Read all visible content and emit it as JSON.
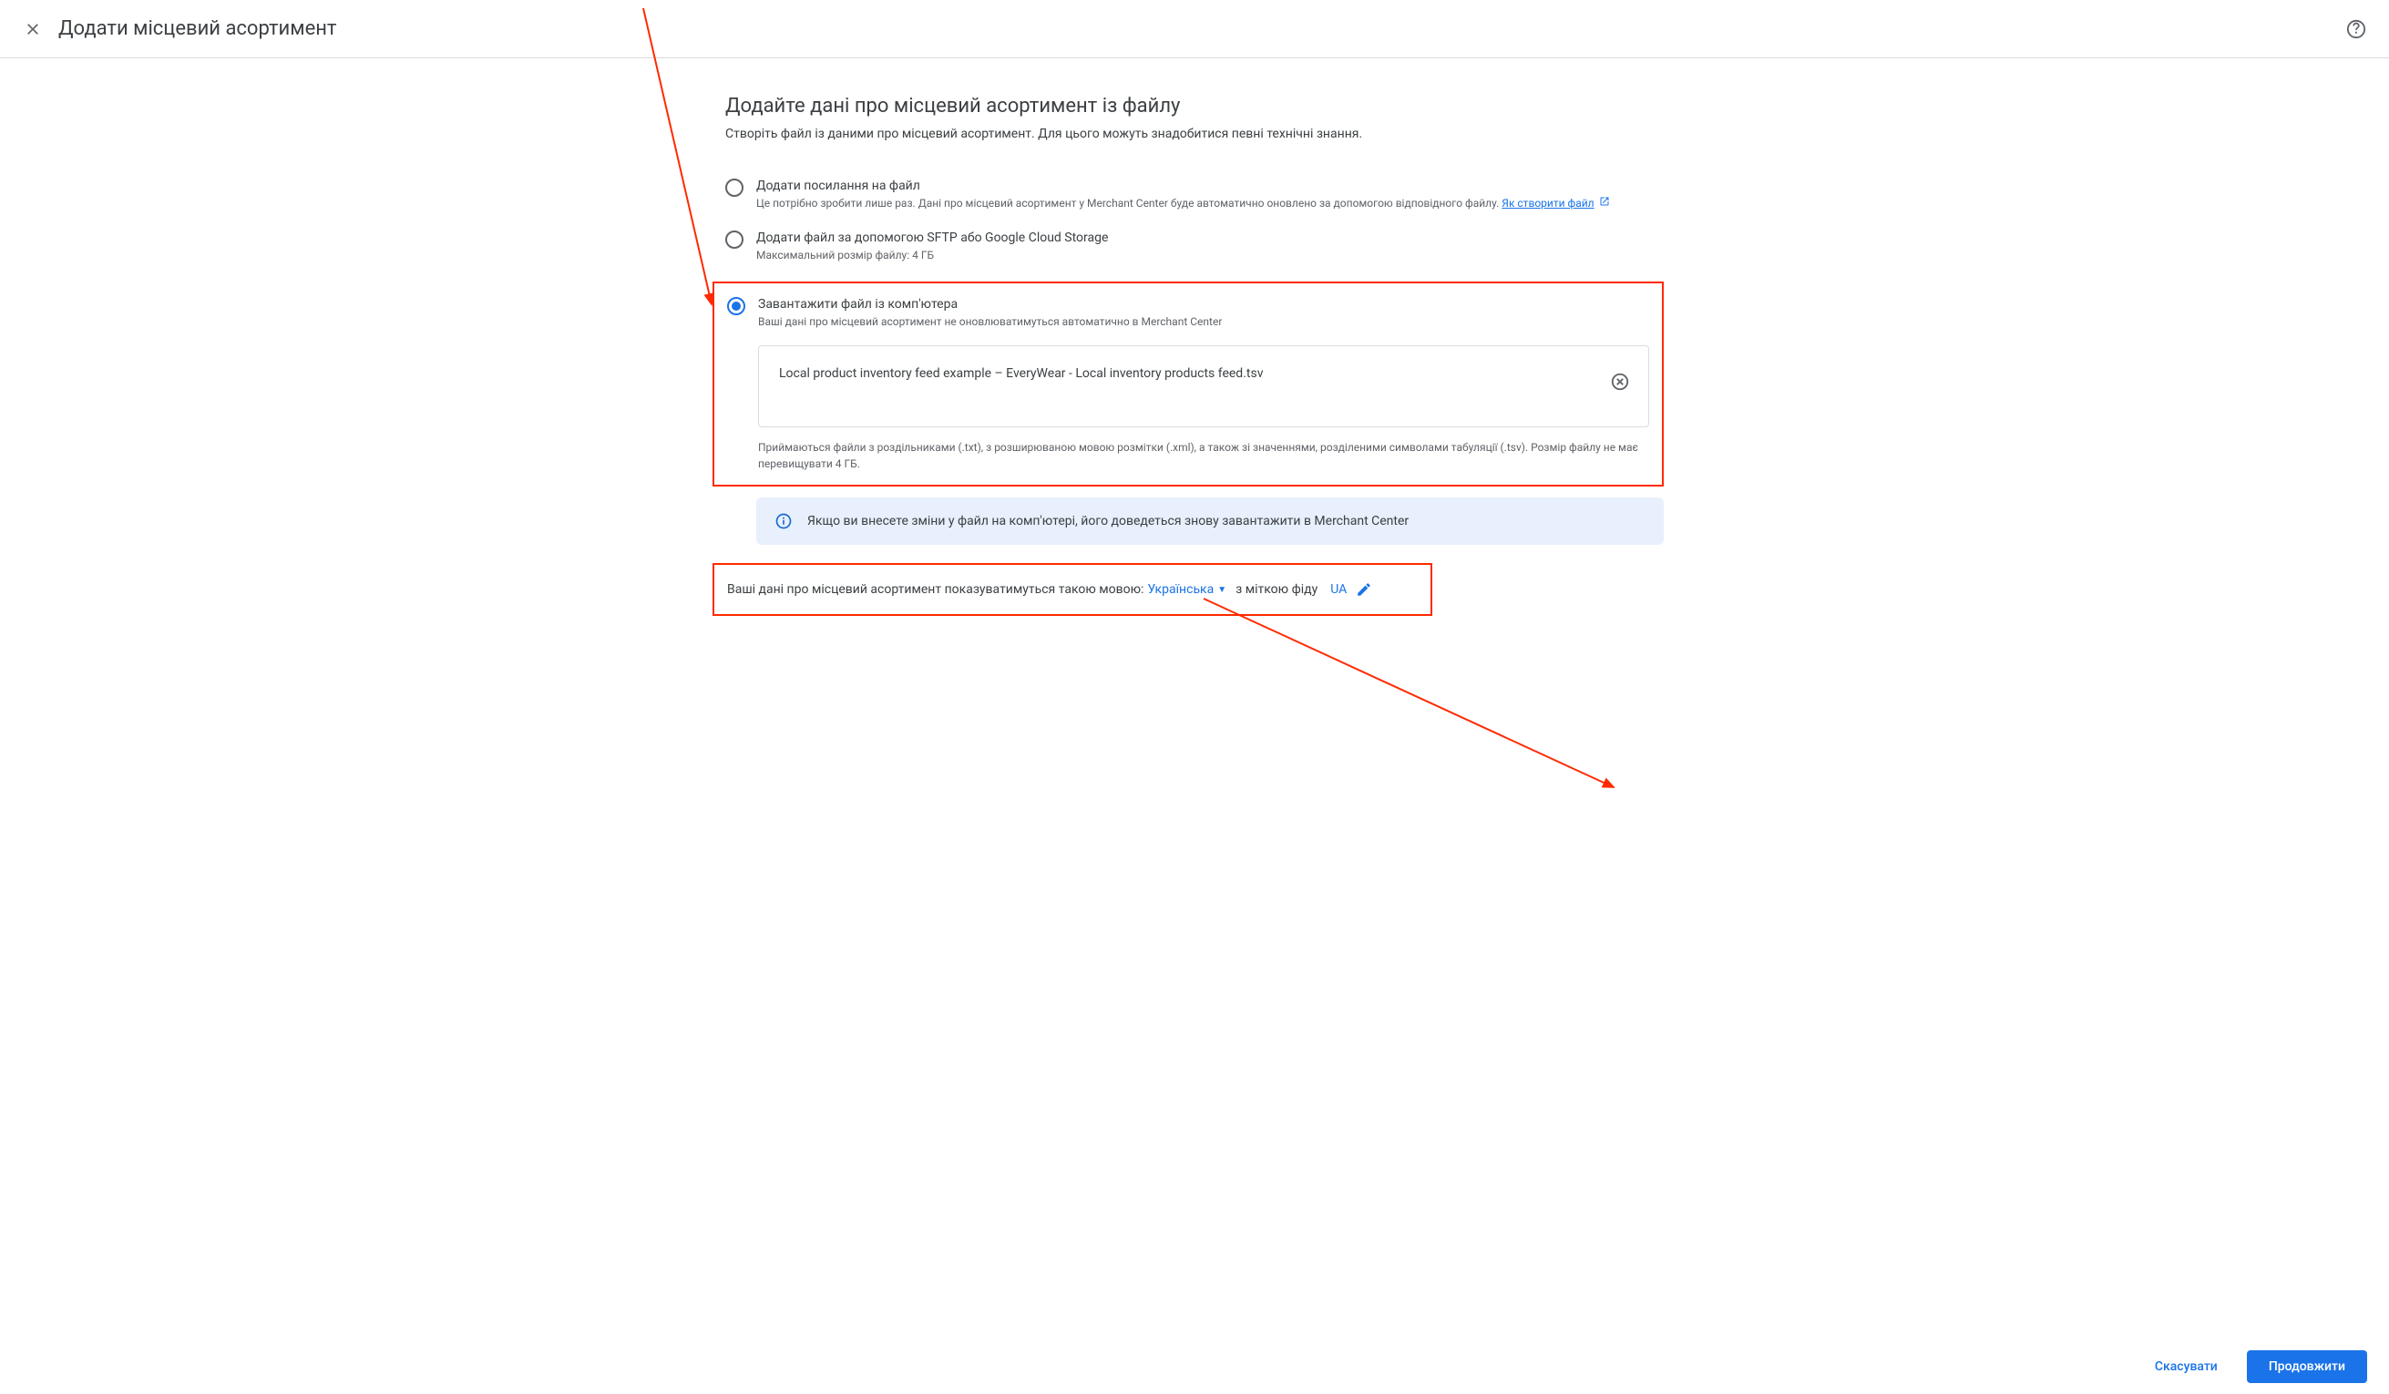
{
  "header": {
    "title": "Додати місцевий асортимент"
  },
  "main": {
    "title": "Додайте дані про місцевий асортимент із файлу",
    "description": "Створіть файл із даними про місцевий асортимент. Для цього можуть знадобитися певні технічні знання."
  },
  "options": {
    "link": {
      "label": "Додати посилання на файл",
      "sub_prefix": "Це потрібно зробити лише раз. Дані про місцевий асортимент у Merchant Center буде автоматично оновлено за допомогою відповідного файлу. ",
      "sub_link": "Як створити файл"
    },
    "sftp": {
      "label": "Додати файл за допомогою SFTP або Google Cloud Storage",
      "sub": "Максимальний розмір файлу: 4 ГБ"
    },
    "upload": {
      "label": "Завантажити файл із комп'ютера",
      "sub": "Ваші дані про місцевий асортимент не оновлюватимуться автоматично в Merchant Center",
      "file_name": "Local product inventory feed example – EveryWear - Local inventory products feed.tsv",
      "file_note": "Приймаються файли з роздільниками (.txt), з розширюваною мовою розмітки (.xml), а також зі значеннями, розділеними символами табуляції (.tsv). Розмір файлу не має перевищувати 4 ГБ."
    }
  },
  "info_banner": "Якщо ви внесете зміни у файл на комп'ютері, його доведеться знову завантажити в Merchant Center",
  "language_row": {
    "prefix": "Ваші дані про місцевий асортимент показуватимуться такою мовою: ",
    "language": "Українська",
    "with_feed_label": "з міткою фіду",
    "feed_label_value": "UA"
  },
  "footer": {
    "cancel": "Скасувати",
    "continue": "Продовжити"
  }
}
